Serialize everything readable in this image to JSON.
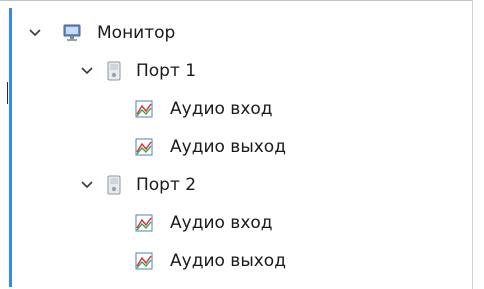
{
  "tree": {
    "root": {
      "label": "Монитор",
      "icon": "monitor-icon",
      "expanded": true
    },
    "ports": [
      {
        "label": "Порт 1",
        "icon": "port-device-icon",
        "expanded": true,
        "children": [
          {
            "label": "Аудио вход",
            "icon": "audio-graph-icon"
          },
          {
            "label": "Аудио выход",
            "icon": "audio-graph-icon"
          }
        ]
      },
      {
        "label": "Порт 2",
        "icon": "port-device-icon",
        "expanded": true,
        "children": [
          {
            "label": "Аудио вход",
            "icon": "audio-graph-icon"
          },
          {
            "label": "Аудио выход",
            "icon": "audio-graph-icon"
          }
        ]
      }
    ]
  },
  "colors": {
    "selection_accent": "#2f8de4",
    "text": "#1a1a1a",
    "chevron": "#3a3a3a"
  }
}
